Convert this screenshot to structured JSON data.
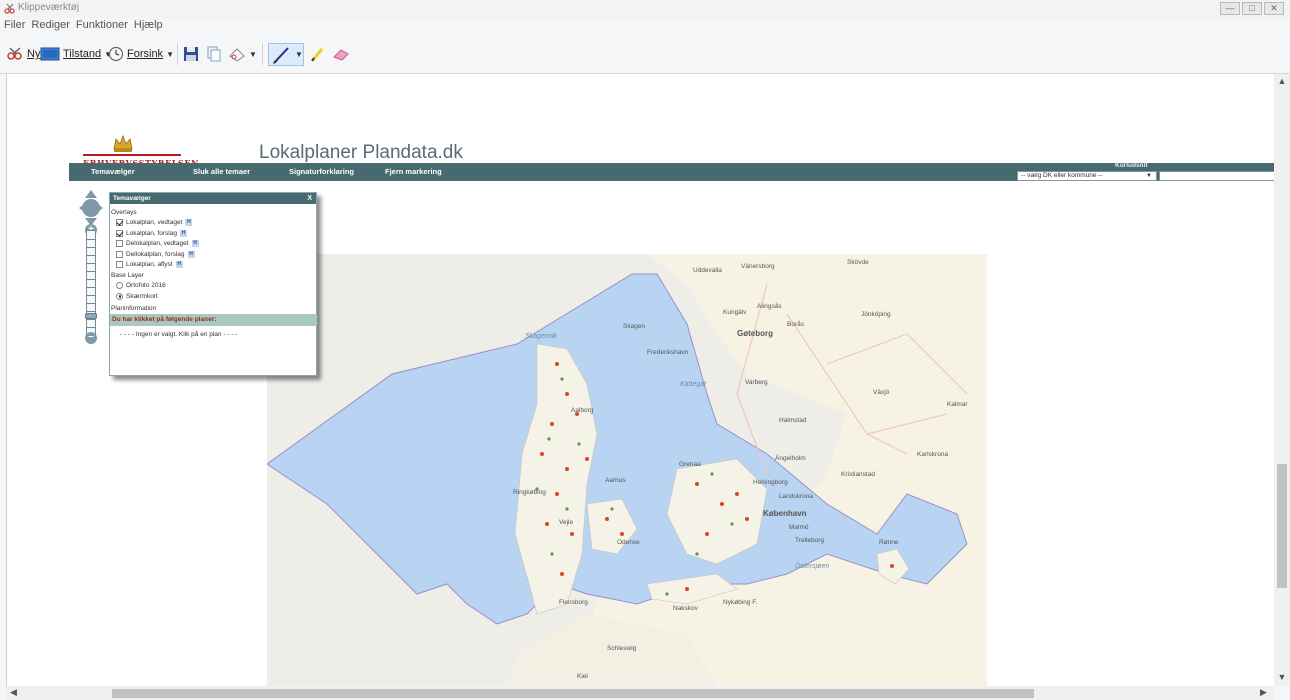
{
  "window": {
    "title": "Klippeværktøj",
    "buttons": [
      "—",
      "□",
      "✕"
    ]
  },
  "menu": [
    "Filer",
    "Rediger",
    "Funktioner",
    "Hjælp"
  ],
  "toolbar": {
    "new_prefix": "",
    "new_label": "Ny",
    "mode_label": "Tilstand",
    "delay_label": "Forsink"
  },
  "page": {
    "logo_text": "ERHVERVSSTYRELSEN",
    "title": "Lokalplaner Plandata.dk",
    "nav": [
      "Temavælger",
      "Sluk alle temaer",
      "Signaturforklaring",
      "Fjern markering"
    ],
    "korlabel": "Korludsnit",
    "kor_select": "-- vælg DK eller kommune --"
  },
  "tema": {
    "title": "Temavælger",
    "close": "X",
    "overlays_label": "Overlays",
    "overlays": [
      {
        "label": "Lokalplan, vedtaget",
        "checked": true
      },
      {
        "label": "Lokalplan, forslag",
        "checked": true
      },
      {
        "label": "Delokalplan, vedtaget",
        "checked": false
      },
      {
        "label": "Dellokalplan, forslag",
        "checked": false
      },
      {
        "label": "Lokalplan, aflyst",
        "checked": false
      }
    ],
    "help_glyph": "H",
    "base_label": "Base Layer",
    "base": [
      {
        "label": "Ortofoto 2016",
        "checked": false
      },
      {
        "label": "Skærmkort",
        "checked": true
      }
    ],
    "planinfo_label": "Planinformation",
    "clicked_label": "Du har klikket på følgende planer:",
    "none_label": "- - - - Ingen er valgt. Klik på en plan - - - -"
  },
  "map": {
    "labels": [
      "Skagerrak",
      "Skagen",
      "Frederikshavn",
      "Aalborg",
      "Kattegat",
      "Grenaa",
      "Aarhus",
      "Ringkøbing",
      "Vejle",
      "Odense",
      "København",
      "Malmö",
      "Helsingborg",
      "Landskrona",
      "Trelleborg",
      "Östersjøen",
      "Rønne",
      "Flensborg",
      "Nakskov",
      "Gøteborg",
      "Uddevalla",
      "Vänersborg",
      "Jönköping",
      "Borås",
      "Kungälv",
      "Alingsås",
      "Varberg",
      "Halmstad",
      "Växjö",
      "Kalmar",
      "Karlskrona",
      "Ängelholm",
      "Kristianstad",
      "Skövde",
      "Schleswig",
      "Kiel",
      "Nykøbing F."
    ],
    "colors": {
      "sea": "#b8d4f2",
      "land": "#f5f2e8",
      "plan_red": "#d8462a",
      "plan_green": "#5f9a3a",
      "road": "#f2c7c0"
    }
  }
}
